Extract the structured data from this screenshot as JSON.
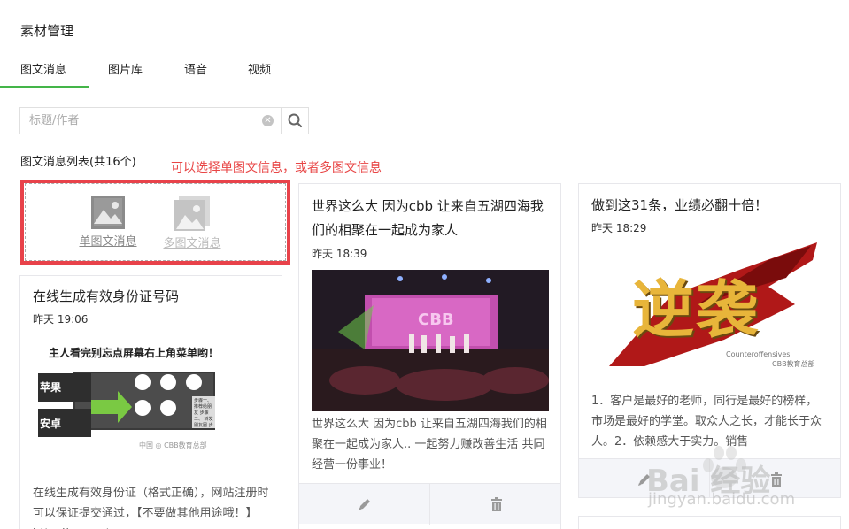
{
  "header": {
    "title": "素材管理"
  },
  "tabs": [
    {
      "label": "图文消息",
      "active": true
    },
    {
      "label": "图片库"
    },
    {
      "label": "语音"
    },
    {
      "label": "视频"
    }
  ],
  "search": {
    "placeholder": "标题/作者",
    "value": ""
  },
  "list": {
    "title": "图文消息列表(共16个)"
  },
  "annotation": "可以选择单图文信息，或者多图文信息",
  "create": {
    "single_label": "单图文消息",
    "multi_label": "多图文消息"
  },
  "cards": {
    "cert": {
      "title": "在线生成有效身份证号码",
      "time": "昨天 19:06",
      "thumb": {
        "banner": "主人看完别忘点屏幕右上角菜单哟！",
        "row1_label": "苹果",
        "row2_label": "安卓",
        "grid_caption": "步骤一、 推荐给朋友 步骤二、 转发朋友圈 步骤三、 关注公众号",
        "footer_mark": "中国 ◎ CBB教育总部"
      },
      "desc": "在线生成有效身份证（格式正确），网站注册时可以保证提交通过，【不要做其他用途哦！】http://www.ot..."
    },
    "world": {
      "title": "世界这么大 因为cbb 让来自五湖四海我们的相聚在一起成为家人",
      "time": "昨天 18:39",
      "thumb": {
        "stage_text": "CBB"
      },
      "desc": "世界这么大 因为cbb 让来自五湖四海我们的相聚在一起成为家人.. 一起努力赚改善生活 共同经营一份事业！"
    },
    "nixi": {
      "title": "做到这31条，业绩必翻十倍！",
      "time": "昨天 18:29",
      "thumb": {
        "big_text": "逆袭",
        "subtitle": "Counteroffensives",
        "mark": "CBB教育总部"
      },
      "desc": "1．客户是最好的老师，同行是最好的榜样，市场是最好的学堂。取众人之长，才能长于众人。2．依赖感大于实力。销售"
    }
  },
  "watermark": {
    "brand": "Bai 经验",
    "url": "jingyan.baidu.com"
  },
  "colors": {
    "accent": "#44b549",
    "annotation": "#e84545",
    "highlight_box": "#e8424a"
  }
}
